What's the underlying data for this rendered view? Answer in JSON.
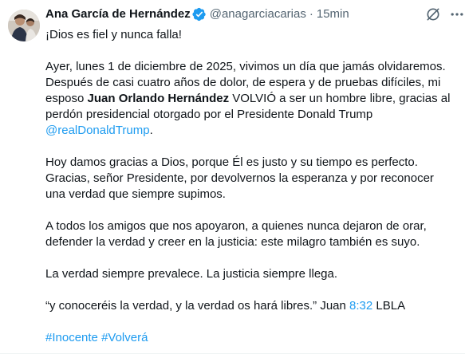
{
  "author": {
    "name": "Ana García de Hernández",
    "handle": "@anagarciacarias",
    "separator": "·",
    "time": "15min"
  },
  "icons": {
    "verified": "verified-badge-icon",
    "grok": "grok-icon",
    "more": "more-dots-icon",
    "accent_color": "#1d9bf0"
  },
  "tweet": {
    "line1": "¡Dios es fiel y nunca falla!",
    "para2_a": "Ayer, lunes 1 de diciembre de 2025, vivimos un día que jamás olvidaremos.",
    "para2_b": "Después de casi cuatro años de dolor, de espera y de pruebas difíciles, mi",
    "para2_c_pre": "esposo ",
    "para2_c_bold": "Juan Orlando Hernández",
    "para2_c_post": " VOLVIÓ a ser un hombre libre, gracias al",
    "para2_d": "perdón presidencial otorgado por el Presidente Donald Trump",
    "para2_mention": "@realDonaldTrump",
    "para2_end": ".",
    "para3_a": "Hoy damos gracias a Dios, porque Él es justo y su tiempo es perfecto.",
    "para3_b": "Gracias, señor Presidente, por devolvernos la esperanza y por reconocer",
    "para3_c": "una verdad que siempre supimos.",
    "para4_a": "A todos los amigos que nos apoyaron, a quienes nunca dejaron de orar,",
    "para4_b": "defender la verdad y creer en la justicia: este milagro también es suyo.",
    "para5": "La verdad siempre prevalece. La justicia siempre llega.",
    "quote_pre": "“y conoceréis la verdad, y la verdad os hará libres.” Juan ",
    "quote_ref": "8:32",
    "quote_post": " LBLA",
    "hashtag1": "#Inocente",
    "hashtag2": "#Volverá"
  }
}
